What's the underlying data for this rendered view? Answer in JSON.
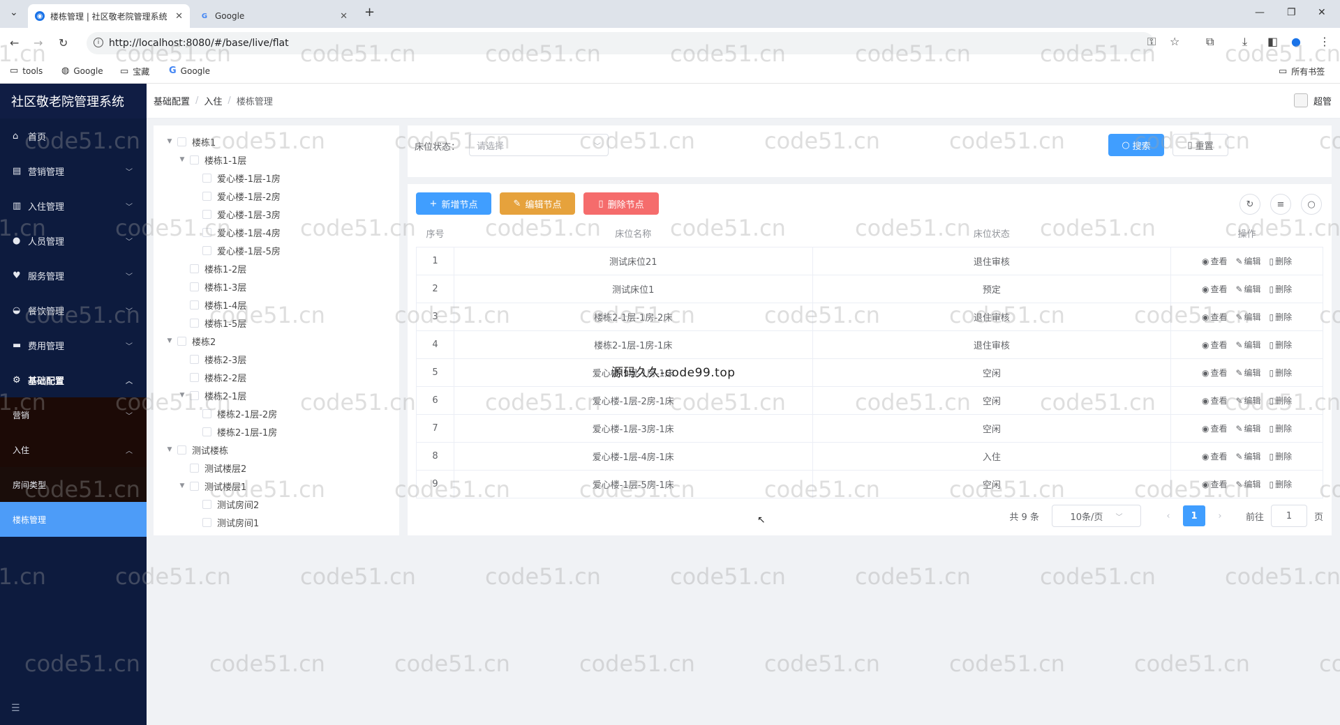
{
  "browser": {
    "tabs": [
      {
        "title": "楼栋管理 | 社区敬老院管理系统",
        "active": true
      },
      {
        "title": "Google",
        "active": false
      }
    ],
    "url": "http://localhost:8080/#/base/live/flat",
    "bookmarks": [
      "tools",
      "Google",
      "宝藏",
      "Google"
    ],
    "all_bookmarks": "所有书签"
  },
  "sidebar": {
    "title": "社区敬老院管理系统",
    "items": [
      {
        "label": "首页",
        "icon": "home-icon"
      },
      {
        "label": "营销管理",
        "icon": "chart-icon"
      },
      {
        "label": "入住管理",
        "icon": "building-icon"
      },
      {
        "label": "人员管理",
        "icon": "user-icon"
      },
      {
        "label": "服务管理",
        "icon": "heart-icon"
      },
      {
        "label": "餐饮管理",
        "icon": "bowl-icon"
      },
      {
        "label": "费用管理",
        "icon": "card-icon"
      },
      {
        "label": "基础配置",
        "icon": "gear-icon"
      }
    ],
    "sub_items": [
      "营销",
      "入住"
    ],
    "subsub_items": [
      "房间类型",
      "楼栋管理"
    ]
  },
  "header": {
    "breadcrumb": [
      "基础配置",
      "入住",
      "楼栋管理"
    ],
    "user": "超管"
  },
  "tree": {
    "nodes": [
      {
        "label": "楼栋1",
        "level": 0,
        "caret": "down"
      },
      {
        "label": "楼栋1-1层",
        "level": 1,
        "caret": "down"
      },
      {
        "label": "爱心楼-1层-1房",
        "level": 2,
        "caret": ""
      },
      {
        "label": "爱心楼-1层-2房",
        "level": 2,
        "caret": ""
      },
      {
        "label": "爱心楼-1层-3房",
        "level": 2,
        "caret": ""
      },
      {
        "label": "爱心楼-1层-4房",
        "level": 2,
        "caret": ""
      },
      {
        "label": "爱心楼-1层-5房",
        "level": 2,
        "caret": ""
      },
      {
        "label": "楼栋1-2层",
        "level": 1,
        "caret": ""
      },
      {
        "label": "楼栋1-3层",
        "level": 1,
        "caret": ""
      },
      {
        "label": "楼栋1-4层",
        "level": 1,
        "caret": ""
      },
      {
        "label": "楼栋1-5层",
        "level": 1,
        "caret": ""
      },
      {
        "label": "楼栋2",
        "level": 0,
        "caret": "down"
      },
      {
        "label": "楼栋2-3层",
        "level": 1,
        "caret": ""
      },
      {
        "label": "楼栋2-2层",
        "level": 1,
        "caret": ""
      },
      {
        "label": "楼栋2-1层",
        "level": 1,
        "caret": "down"
      },
      {
        "label": "楼栋2-1层-2房",
        "level": 2,
        "caret": ""
      },
      {
        "label": "楼栋2-1层-1房",
        "level": 2,
        "caret": ""
      },
      {
        "label": "测试楼栋",
        "level": 0,
        "caret": "down"
      },
      {
        "label": "测试楼层2",
        "level": 1,
        "caret": ""
      },
      {
        "label": "测试楼层1",
        "level": 1,
        "caret": "down"
      },
      {
        "label": "测试房间2",
        "level": 2,
        "caret": ""
      },
      {
        "label": "测试房间1",
        "level": 2,
        "caret": ""
      }
    ]
  },
  "search": {
    "label": "床位状态：",
    "placeholder": "请选择",
    "search_btn": "搜索",
    "reset_btn": "重置"
  },
  "toolbar": {
    "add": "新增节点",
    "edit": "编辑节点",
    "delete": "删除节点"
  },
  "table": {
    "columns": [
      "序号",
      "床位名称",
      "床位状态",
      "操作"
    ],
    "rows": [
      {
        "no": "1",
        "name": "测试床位21",
        "status": "退住审核"
      },
      {
        "no": "2",
        "name": "测试床位1",
        "status": "预定"
      },
      {
        "no": "3",
        "name": "楼栋2-1层-1房-2床",
        "status": "退住审核"
      },
      {
        "no": "4",
        "name": "楼栋2-1层-1房-1床",
        "status": "退住审核"
      },
      {
        "no": "5",
        "name": "爱心楼-1层-1房-1床",
        "status": "空闲"
      },
      {
        "no": "6",
        "name": "爱心楼-1层-2房-1床",
        "status": "空闲"
      },
      {
        "no": "7",
        "name": "爱心楼-1层-3房-1床",
        "status": "空闲"
      },
      {
        "no": "8",
        "name": "爱心楼-1层-4房-1床",
        "status": "入住"
      },
      {
        "no": "9",
        "name": "爱心楼-1层-5房-1床",
        "status": "空闲"
      }
    ],
    "ops": {
      "view": "查看",
      "edit": "编辑",
      "delete": "删除"
    }
  },
  "pagination": {
    "total": "共 9 条",
    "page_size": "10条/页",
    "current": "1",
    "goto_label": "前往",
    "goto_value": "1",
    "page_unit": "页"
  },
  "overlay": "源码久久-code99.top",
  "watermark": "code51.cn",
  "colors": {
    "sidebar_bg": "#0d1b3e",
    "selected": "#4d9cf8",
    "primary": "#409eff",
    "warning": "#e6a23c",
    "danger": "#f56c6c"
  }
}
